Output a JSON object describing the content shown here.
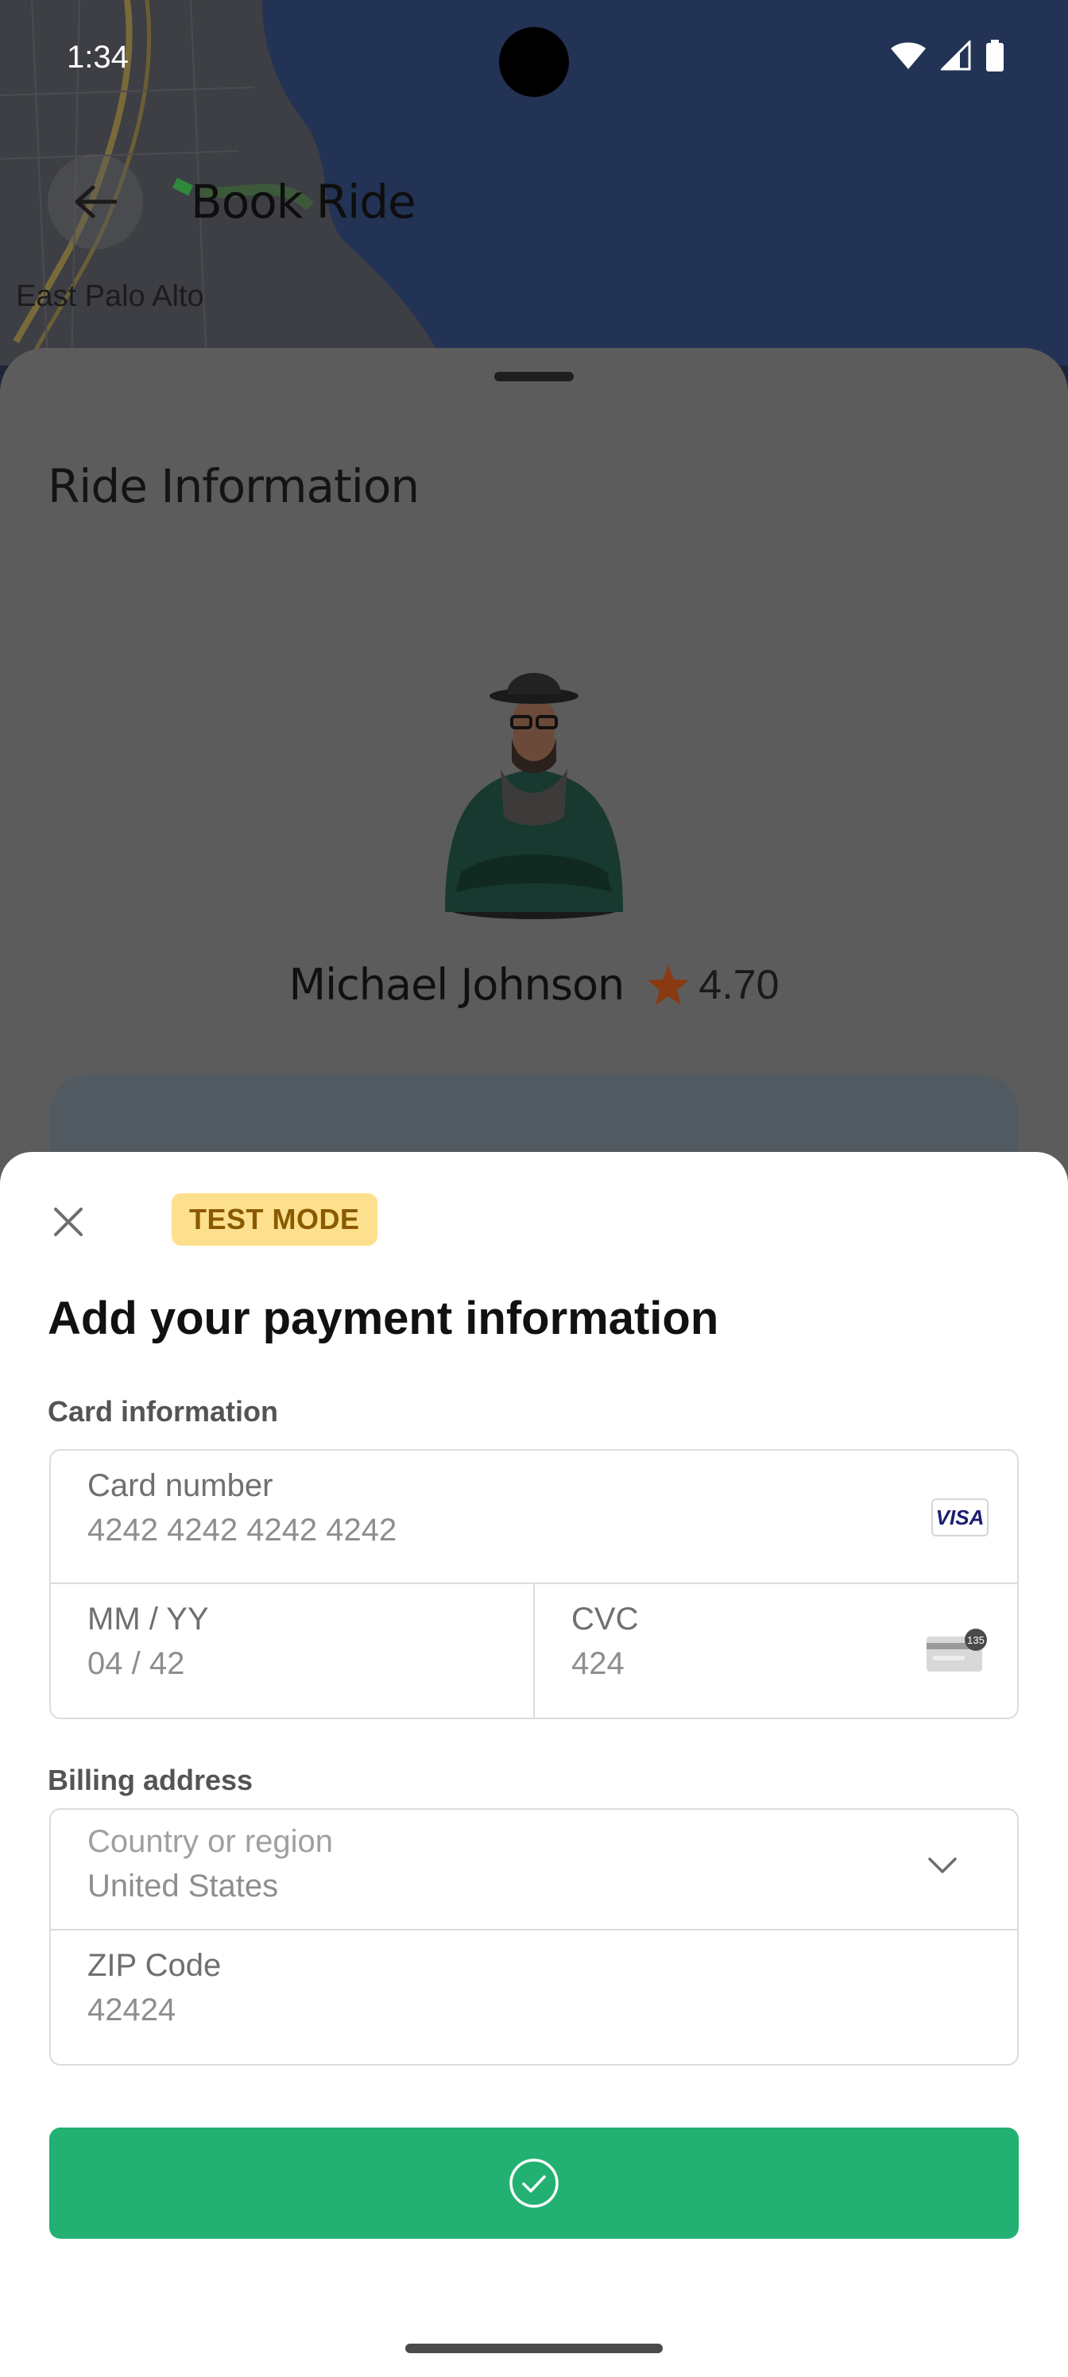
{
  "status_bar": {
    "time": "1:34"
  },
  "header": {
    "title": "Book Ride"
  },
  "map": {
    "place_label": "East Palo Alto"
  },
  "ride_sheet": {
    "section_title": "Ride Information",
    "driver": {
      "name": "Michael Johnson",
      "rating": "4.70"
    }
  },
  "payment": {
    "badge": "TEST MODE",
    "title": "Add your payment information",
    "card_section_label": "Card information",
    "card_number": {
      "label": "Card number",
      "value": "4242 4242 4242 4242",
      "brand": "VISA"
    },
    "expiry": {
      "label": "MM / YY",
      "value": "04 / 42"
    },
    "cvc": {
      "label": "CVC",
      "value": "424",
      "icon_text": "135"
    },
    "billing_section_label": "Billing address",
    "country": {
      "label": "Country or region",
      "value": "United States"
    },
    "zip": {
      "label": "ZIP Code",
      "value": "42424"
    }
  },
  "colors": {
    "accent_green": "#22b172",
    "badge_bg": "#fde08d",
    "star": "#d9480f"
  }
}
